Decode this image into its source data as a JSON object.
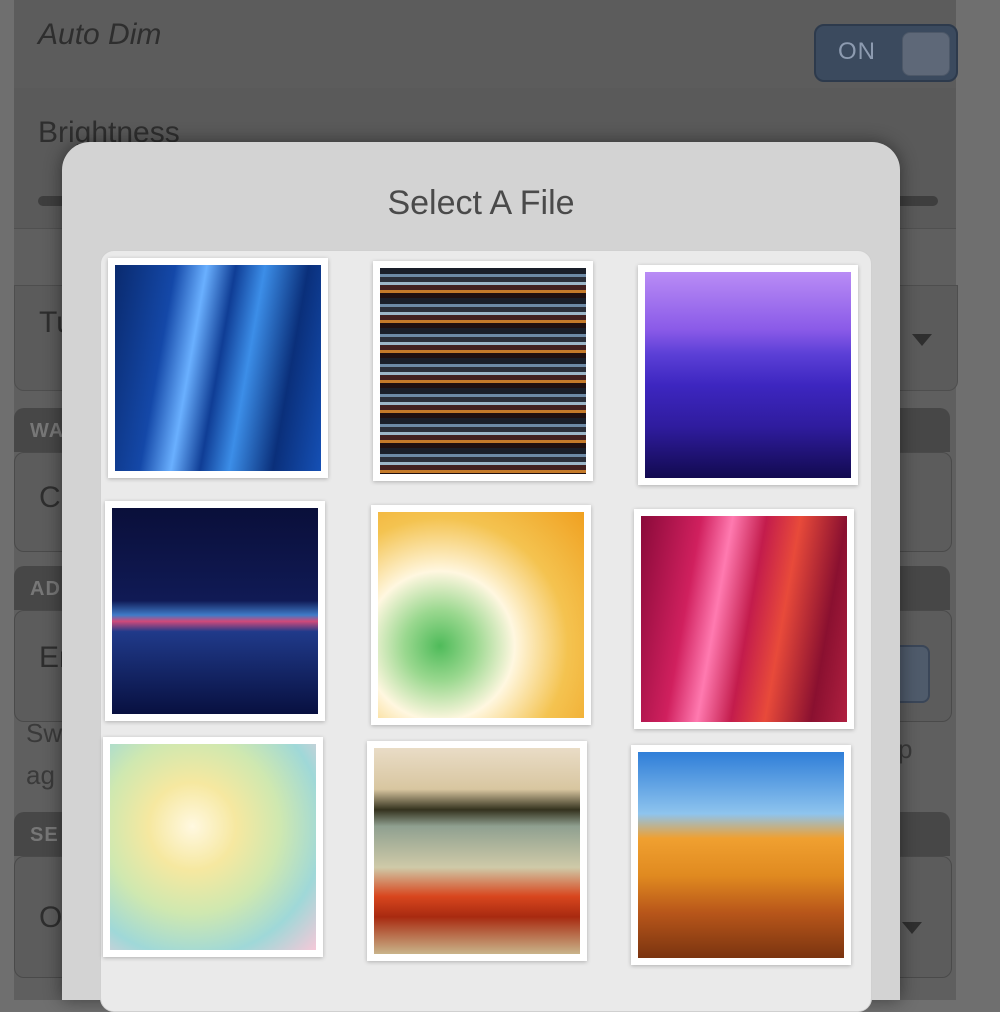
{
  "settings": {
    "auto_dim_label": "Auto Dim",
    "auto_dim_toggle": "ON",
    "brightness_label": "Brightness",
    "turn_label_partial": "Tu",
    "wallpaper_header_partial": "WA",
    "change_label_partial": "Ch",
    "advanced_header_partial": "AD",
    "enable_label_partial": "En",
    "swipe_text_partial": "Sw",
    "ag_text_partial": "ag",
    "p_text_partial": "p",
    "security_header_partial": "SE",
    "off_label_partial": "Of"
  },
  "dialog": {
    "title": "Select A File",
    "files": [
      {
        "name": "blue-streaks"
      },
      {
        "name": "horizontal-stripes"
      },
      {
        "name": "purple-pier"
      },
      {
        "name": "night-skyline"
      },
      {
        "name": "dandelion-flower"
      },
      {
        "name": "pink-streaks"
      },
      {
        "name": "blossom-bokeh"
      },
      {
        "name": "hot-spring"
      },
      {
        "name": "desert-dunes"
      }
    ]
  },
  "colors": {
    "dialog_bg": "#d3d3d3",
    "toggle_bg": "#3b4a5e",
    "screen_bg": "#5f5f5f"
  }
}
